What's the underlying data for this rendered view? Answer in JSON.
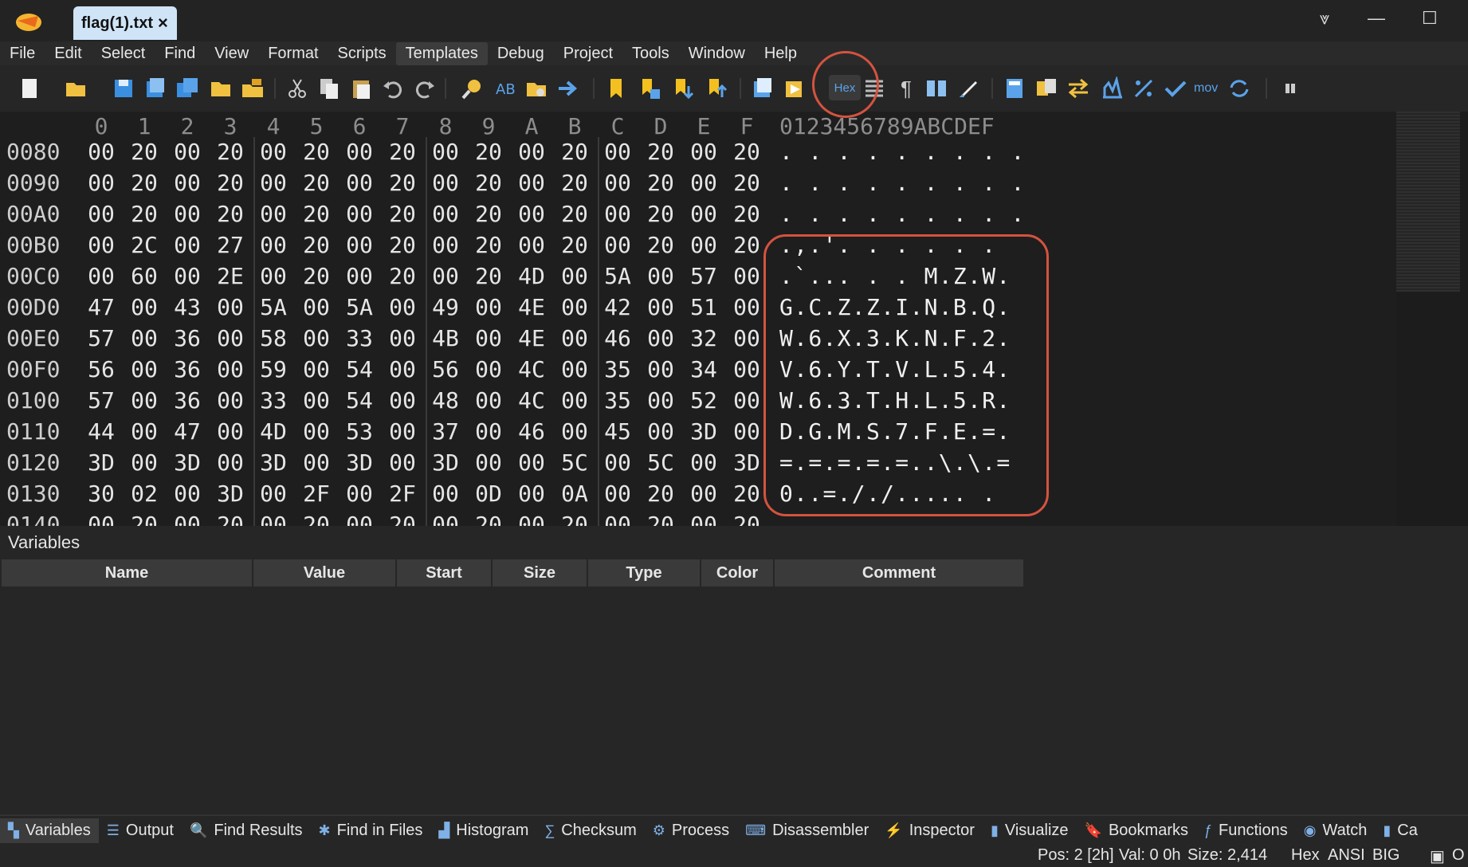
{
  "window": {
    "tab_title": "flag(1).txt",
    "tab_close": "×",
    "minimize": "—",
    "maximize": "☐",
    "menu_overflow": "⩔"
  },
  "menu": [
    "File",
    "Edit",
    "Select",
    "Find",
    "View",
    "Format",
    "Scripts",
    "Templates",
    "Debug",
    "Project",
    "Tools",
    "Window",
    "Help"
  ],
  "toolbar": {
    "hex_button_label": "Hex",
    "mov_label": "mov",
    "pilcrow": "¶"
  },
  "hex": {
    "columns": [
      "0",
      "1",
      "2",
      "3",
      "4",
      "5",
      "6",
      "7",
      "8",
      "9",
      "A",
      "B",
      "C",
      "D",
      "E",
      "F"
    ],
    "ascii_header": "0123456789ABCDEF",
    "rows": [
      {
        "addr": "0080",
        "bytes": [
          "00",
          "20",
          "00",
          "20",
          "00",
          "20",
          "00",
          "20",
          "00",
          "20",
          "00",
          "20",
          "00",
          "20",
          "00",
          "20"
        ],
        "ascii": ". . . . . . . . ."
      },
      {
        "addr": "0090",
        "bytes": [
          "00",
          "20",
          "00",
          "20",
          "00",
          "20",
          "00",
          "20",
          "00",
          "20",
          "00",
          "20",
          "00",
          "20",
          "00",
          "20"
        ],
        "ascii": ". . . . . . . . ."
      },
      {
        "addr": "00A0",
        "bytes": [
          "00",
          "20",
          "00",
          "20",
          "00",
          "20",
          "00",
          "20",
          "00",
          "20",
          "00",
          "20",
          "00",
          "20",
          "00",
          "20"
        ],
        "ascii": ". . . . . . . . ."
      },
      {
        "addr": "00B0",
        "bytes": [
          "00",
          "2C",
          "00",
          "27",
          "00",
          "20",
          "00",
          "20",
          "00",
          "20",
          "00",
          "20",
          "00",
          "20",
          "00",
          "20"
        ],
        "ascii": ".,.'. . . . . ."
      },
      {
        "addr": "00C0",
        "bytes": [
          "00",
          "60",
          "00",
          "2E",
          "00",
          "20",
          "00",
          "20",
          "00",
          "20",
          "4D",
          "00",
          "5A",
          "00",
          "57",
          "00"
        ],
        "ascii": ".`... . . M.Z.W."
      },
      {
        "addr": "00D0",
        "bytes": [
          "47",
          "00",
          "43",
          "00",
          "5A",
          "00",
          "5A",
          "00",
          "49",
          "00",
          "4E",
          "00",
          "42",
          "00",
          "51",
          "00"
        ],
        "ascii": "G.C.Z.Z.I.N.B.Q."
      },
      {
        "addr": "00E0",
        "bytes": [
          "57",
          "00",
          "36",
          "00",
          "58",
          "00",
          "33",
          "00",
          "4B",
          "00",
          "4E",
          "00",
          "46",
          "00",
          "32",
          "00"
        ],
        "ascii": "W.6.X.3.K.N.F.2."
      },
      {
        "addr": "00F0",
        "bytes": [
          "56",
          "00",
          "36",
          "00",
          "59",
          "00",
          "54",
          "00",
          "56",
          "00",
          "4C",
          "00",
          "35",
          "00",
          "34",
          "00"
        ],
        "ascii": "V.6.Y.T.V.L.5.4."
      },
      {
        "addr": "0100",
        "bytes": [
          "57",
          "00",
          "36",
          "00",
          "33",
          "00",
          "54",
          "00",
          "48",
          "00",
          "4C",
          "00",
          "35",
          "00",
          "52",
          "00"
        ],
        "ascii": "W.6.3.T.H.L.5.R."
      },
      {
        "addr": "0110",
        "bytes": [
          "44",
          "00",
          "47",
          "00",
          "4D",
          "00",
          "53",
          "00",
          "37",
          "00",
          "46",
          "00",
          "45",
          "00",
          "3D",
          "00"
        ],
        "ascii": "D.G.M.S.7.F.E.=."
      },
      {
        "addr": "0120",
        "bytes": [
          "3D",
          "00",
          "3D",
          "00",
          "3D",
          "00",
          "3D",
          "00",
          "3D",
          "00",
          "00",
          "5C",
          "00",
          "5C",
          "00",
          "3D"
        ],
        "ascii": "=.=.=.=.=..\\.\\.="
      },
      {
        "addr": "0130",
        "bytes": [
          "30",
          "02",
          "00",
          "3D",
          "00",
          "2F",
          "00",
          "2F",
          "00",
          "0D",
          "00",
          "0A",
          "00",
          "20",
          "00",
          "20"
        ],
        "ascii": "0..=././..... ."
      },
      {
        "addr": "0140",
        "bytes": [
          "00",
          "20",
          "00",
          "20",
          "00",
          "20",
          "00",
          "20",
          "00",
          "20",
          "00",
          "20",
          "00",
          "20",
          "00",
          "20"
        ],
        "ascii": ""
      }
    ]
  },
  "variables": {
    "title": "Variables",
    "columns": [
      "Name",
      "Value",
      "Start",
      "Size",
      "Type",
      "Color",
      "Comment"
    ]
  },
  "bottom_tabs": [
    {
      "label": "Variables",
      "icon": "variables-icon",
      "glyph": "▚",
      "active": true
    },
    {
      "label": "Output",
      "icon": "output-icon",
      "glyph": "☰",
      "active": false
    },
    {
      "label": "Find Results",
      "icon": "find-results-icon",
      "glyph": "🔍",
      "active": false
    },
    {
      "label": "Find in Files",
      "icon": "find-in-files-icon",
      "glyph": "✱",
      "active": false
    },
    {
      "label": "Histogram",
      "icon": "histogram-icon",
      "glyph": "▟",
      "active": false
    },
    {
      "label": "Checksum",
      "icon": "checksum-icon",
      "glyph": "∑",
      "active": false
    },
    {
      "label": "Process",
      "icon": "process-icon",
      "glyph": "⚙",
      "active": false
    },
    {
      "label": "Disassembler",
      "icon": "disassembler-icon",
      "glyph": "⌨",
      "active": false
    },
    {
      "label": "Inspector",
      "icon": "inspector-icon",
      "glyph": "⚡",
      "active": false
    },
    {
      "label": "Visualize",
      "icon": "visualize-icon",
      "glyph": "▮",
      "active": false
    },
    {
      "label": "Bookmarks",
      "icon": "bookmarks-icon",
      "glyph": "🔖",
      "active": false
    },
    {
      "label": "Functions",
      "icon": "functions-icon",
      "glyph": "ƒ",
      "active": false
    },
    {
      "label": "Watch",
      "icon": "watch-icon",
      "glyph": "◉",
      "active": false
    },
    {
      "label": "Ca",
      "icon": "calculator-icon",
      "glyph": "▮",
      "active": false
    }
  ],
  "status": {
    "pos": "Pos: 2 [2h]",
    "val": "Val: 0 0h",
    "size": "Size: 2,414",
    "mode": "Hex",
    "encoding": "ANSI",
    "endian": "BIG",
    "ovr": "O"
  },
  "colors": {
    "annotation": "#d4533f",
    "tab_active": "#cfe4f7",
    "background": "#262626"
  }
}
